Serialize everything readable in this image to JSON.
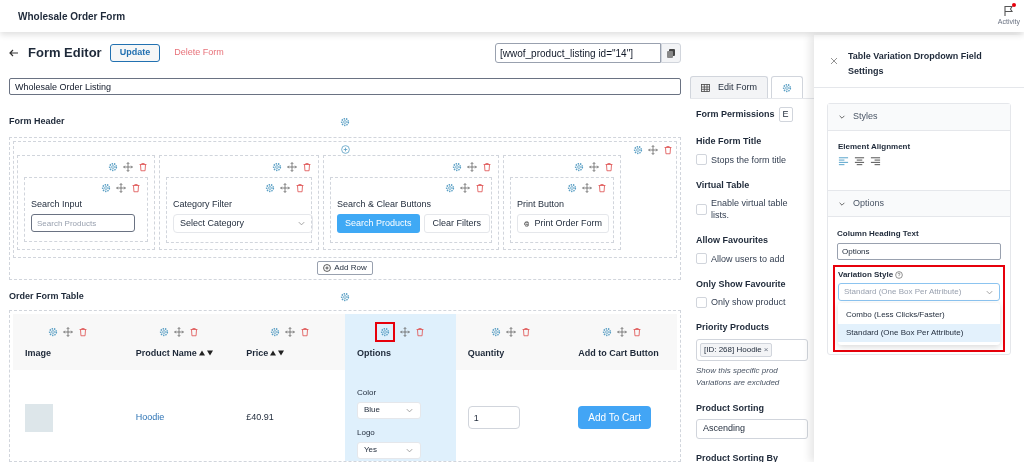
{
  "top_bar": {
    "title": "Wholesale Order Form",
    "activity": {
      "label": "Activity",
      "unread": true
    }
  },
  "editor": {
    "title": "Form Editor",
    "update_button": "Update",
    "delete_link": "Delete Form",
    "shortcode": "[wwof_product_listing id=\"14\"]",
    "form_name": "Wholesale Order Listing"
  },
  "form_header": {
    "title": "Form Header",
    "add_row": "Add Row",
    "columns": [
      {
        "kind": "input",
        "label": "Search Input",
        "placeholder": "Search Products"
      },
      {
        "kind": "select",
        "label": "Category Filter",
        "value": "Select Category"
      },
      {
        "kind": "buttons",
        "label": "Search & Clear Buttons",
        "buttons": [
          {
            "label": "Search Products",
            "primary": true
          },
          {
            "label": "Clear Filters",
            "primary": false
          }
        ]
      },
      {
        "kind": "print",
        "label": "Print Button",
        "button": "Print Order Form"
      }
    ]
  },
  "order_form_table": {
    "title": "Order Form Table",
    "columns": [
      {
        "label": "Image",
        "sortable": false,
        "selected": false,
        "highlighted": false
      },
      {
        "label": "Product Name",
        "sortable": true,
        "selected": false,
        "highlighted": false
      },
      {
        "label": "Price",
        "sortable": true,
        "selected": false,
        "highlighted": false
      },
      {
        "label": "Options",
        "sortable": false,
        "selected": true,
        "highlighted": true
      },
      {
        "label": "Quantity",
        "sortable": false,
        "selected": false,
        "highlighted": false
      },
      {
        "label": "Add to Cart Button",
        "sortable": false,
        "selected": false,
        "highlighted": false
      }
    ],
    "rows": [
      {
        "product": "Hoodie",
        "price": "£40.91",
        "options": [
          {
            "label": "Color",
            "value": "Blue"
          },
          {
            "label": "Logo",
            "value": "Yes"
          }
        ],
        "quantity": "1",
        "button": "Add To Cart"
      }
    ]
  },
  "settings_panel": {
    "tabs": [
      {
        "kind": "table",
        "label": "Edit Form",
        "selected": false
      },
      {
        "kind": "gear",
        "selected": true
      }
    ],
    "fields": [
      {
        "kind": "select",
        "label": "Form Permissions",
        "value": "E"
      },
      {
        "kind": "checkbox",
        "label": "Hide Form Title",
        "lines": [
          "Stops the form title"
        ],
        "checked": false
      },
      {
        "kind": "checkbox",
        "label": "Virtual Table",
        "lines": [
          "Enable virtual table",
          "lists."
        ],
        "checked": false
      },
      {
        "kind": "checkbox",
        "label": "Allow Favourites",
        "lines": [
          "Allow users to add"
        ],
        "checked": false
      },
      {
        "kind": "checkbox",
        "label": "Only Show Favourite",
        "lines": [
          "Only show product"
        ],
        "checked": false
      },
      {
        "kind": "tags",
        "label": "Priority Products",
        "tags": [
          {
            "label": "[ID: 268] Hoodie",
            "remove": "×"
          }
        ],
        "help_lines": [
          "Show this specific prod",
          "Variations are excluded"
        ]
      },
      {
        "kind": "select",
        "label": "Product Sorting",
        "value": "Ascending"
      },
      {
        "kind": "heading",
        "label": "Product Sorting By"
      }
    ]
  },
  "field_settings": {
    "title": "Table Variation Dropdown Field Settings",
    "sections": [
      {
        "kind": "styles",
        "title": "Styles",
        "expanded": true,
        "label": "Element Alignment",
        "alignments": [
          {
            "kind": "left",
            "selected": true
          },
          {
            "kind": "center",
            "selected": false
          },
          {
            "kind": "right",
            "selected": false
          }
        ]
      },
      {
        "kind": "options",
        "title": "Options",
        "expanded": true,
        "heading_label": "Column Heading Text",
        "heading_value": "Options",
        "variation": {
          "label": "Variation Style",
          "value": "Standard (One Box Per Attribute)",
          "open": true,
          "highlighted": true,
          "options": [
            {
              "label": "Combo (Less Clicks/Faster)",
              "selected": false
            },
            {
              "label": "Standard (One Box Per Attribute)",
              "selected": true
            }
          ]
        }
      }
    ]
  }
}
